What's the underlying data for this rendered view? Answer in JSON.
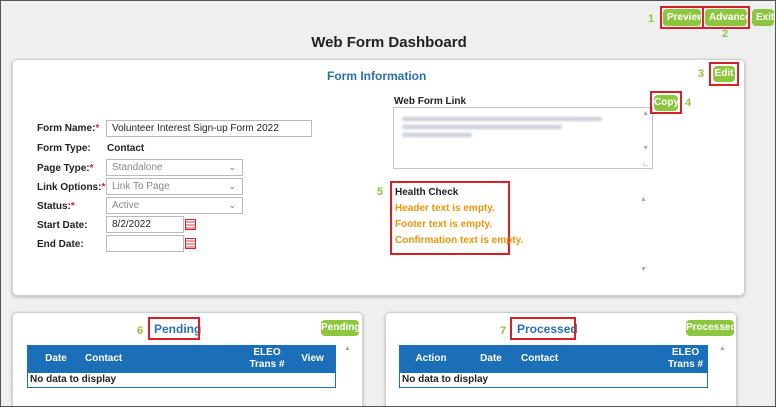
{
  "top_buttons": {
    "preview": "Preview",
    "advanced": "Advanced",
    "exit": "Exit"
  },
  "callouts": {
    "c1": "1",
    "c2": "2",
    "c3": "3",
    "c4": "4",
    "c5": "5",
    "c6": "6",
    "c7": "7"
  },
  "page_title": "Web Form Dashboard",
  "form_info": {
    "title": "Form Information",
    "edit_label": "Edit",
    "fields": {
      "form_name": {
        "label": "Form Name:",
        "required": "*",
        "value": "Volunteer Interest Sign-up Form 2022"
      },
      "form_type": {
        "label": "Form Type:",
        "value": "Contact"
      },
      "page_type": {
        "label": "Page Type:",
        "required": "*",
        "value": "Standalone"
      },
      "link_options": {
        "label": "Link Options:",
        "required": "*",
        "value": "Link To Page"
      },
      "status": {
        "label": "Status:",
        "required": "*",
        "value": "Active"
      },
      "start_date": {
        "label": "Start Date:",
        "value": "8/2/2022"
      },
      "end_date": {
        "label": "End Date:",
        "value": ""
      }
    },
    "web_form_link": {
      "label": "Web Form Link",
      "copy_label": "Copy"
    },
    "health_check": {
      "title": "Health Check",
      "items": [
        "Header text is empty.",
        "Footer text is empty.",
        "Confirmation text is empty."
      ]
    }
  },
  "pending": {
    "title": "Pending",
    "button": "Pending",
    "columns": [
      "Date",
      "Contact",
      "ELEO Trans #",
      "View"
    ],
    "empty": "No data to display"
  },
  "processed": {
    "title": "Processed",
    "button": "Processed",
    "columns": [
      "Action",
      "Date",
      "Contact",
      "ELEO Trans #"
    ],
    "empty": "No data to display"
  },
  "colors": {
    "accent_green": "#8cc63f",
    "header_blue": "#1b6eb8",
    "title_blue": "#2a6fb3",
    "warning_orange": "#e8960c",
    "highlight_red": "#d9202a"
  }
}
